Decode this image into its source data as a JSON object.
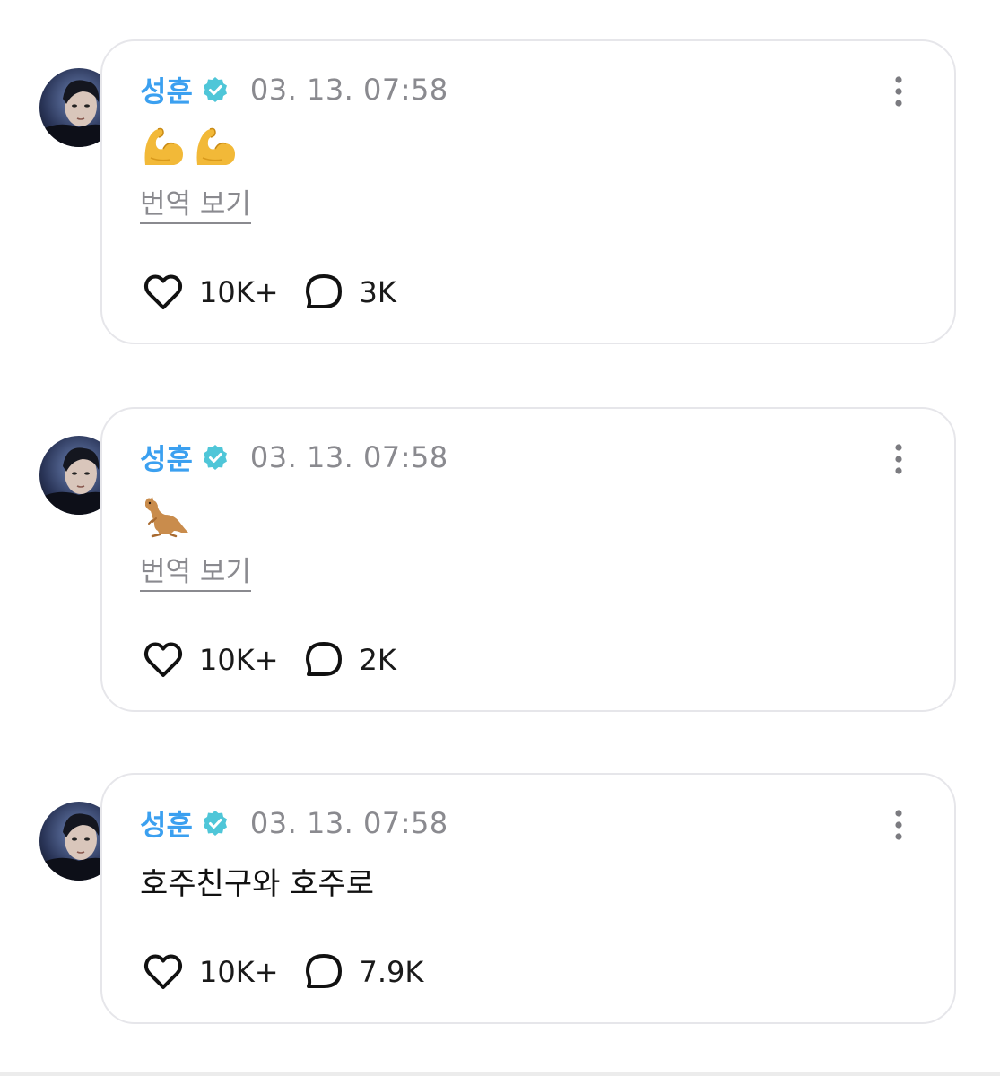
{
  "posts": [
    {
      "author": "성훈",
      "timestamp": "03. 13. 07:58",
      "content_type": "emoji",
      "emojis": [
        "flexed-biceps",
        "flexed-biceps"
      ],
      "content_text": "",
      "translate_label": "번역 보기",
      "likes": "10K+",
      "comments": "3K"
    },
    {
      "author": "성훈",
      "timestamp": "03. 13. 07:58",
      "content_type": "emoji",
      "emojis": [
        "kangaroo"
      ],
      "content_text": "",
      "translate_label": "번역 보기",
      "likes": "10K+",
      "comments": "2K"
    },
    {
      "author": "성훈",
      "timestamp": "03. 13. 07:58",
      "content_type": "text",
      "emojis": [],
      "content_text": "호주친구와 호주로",
      "translate_label": "",
      "likes": "10K+",
      "comments": "7.9K"
    }
  ],
  "colors": {
    "author": "#3ba0f0",
    "verified_badge": "#4fc6d8",
    "timestamp": "#8a8a8f",
    "card_border": "#e6e6ea"
  },
  "icons": {
    "verified": "verified-badge-icon",
    "more": "more-vertical-icon",
    "like": "heart-icon",
    "comment": "comment-bubble-icon"
  }
}
